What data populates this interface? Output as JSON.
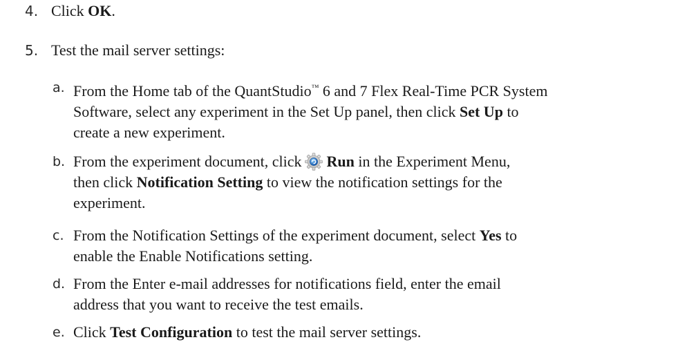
{
  "steps": [
    {
      "number": "4.",
      "pre": "Click ",
      "bold": "OK",
      "post": "."
    },
    {
      "number": "5.",
      "text": "Test the mail server settings:"
    }
  ],
  "substeps": {
    "a": {
      "letter": "a.",
      "l1_pre": "From the Home tab of the QuantStudio",
      "tm": "™",
      "l1_post": " 6 and 7 Flex Real-Time PCR System",
      "l2_pre": "Software, select any experiment in the Set Up panel, then click ",
      "l2_bold": "Set Up",
      "l2_post": " to",
      "l3": "create a new experiment."
    },
    "b": {
      "letter": "b.",
      "l1_pre": "From the experiment document, click",
      "icon": "run-gear-icon",
      "l1_bold": "Run",
      "l1_post": " in the Experiment Menu,",
      "l2_pre": "then click ",
      "l2_bold": "Notification Setting",
      "l2_post": " to view the notification settings for the",
      "l3": "experiment."
    },
    "c": {
      "letter": "c.",
      "l1_pre": "From the Notification Settings of the experiment document, select ",
      "l1_bold": "Yes",
      "l1_post": " to",
      "l2": "enable the Enable Notifications setting."
    },
    "d": {
      "letter": "d.",
      "l1": "From the Enter e-mail addresses for notifications field, enter the email",
      "l2": "address that you want to receive the test emails."
    },
    "e": {
      "letter": "e.",
      "pre": "Click ",
      "bold": "Test Configuration",
      "post": " to test the mail server settings."
    }
  }
}
